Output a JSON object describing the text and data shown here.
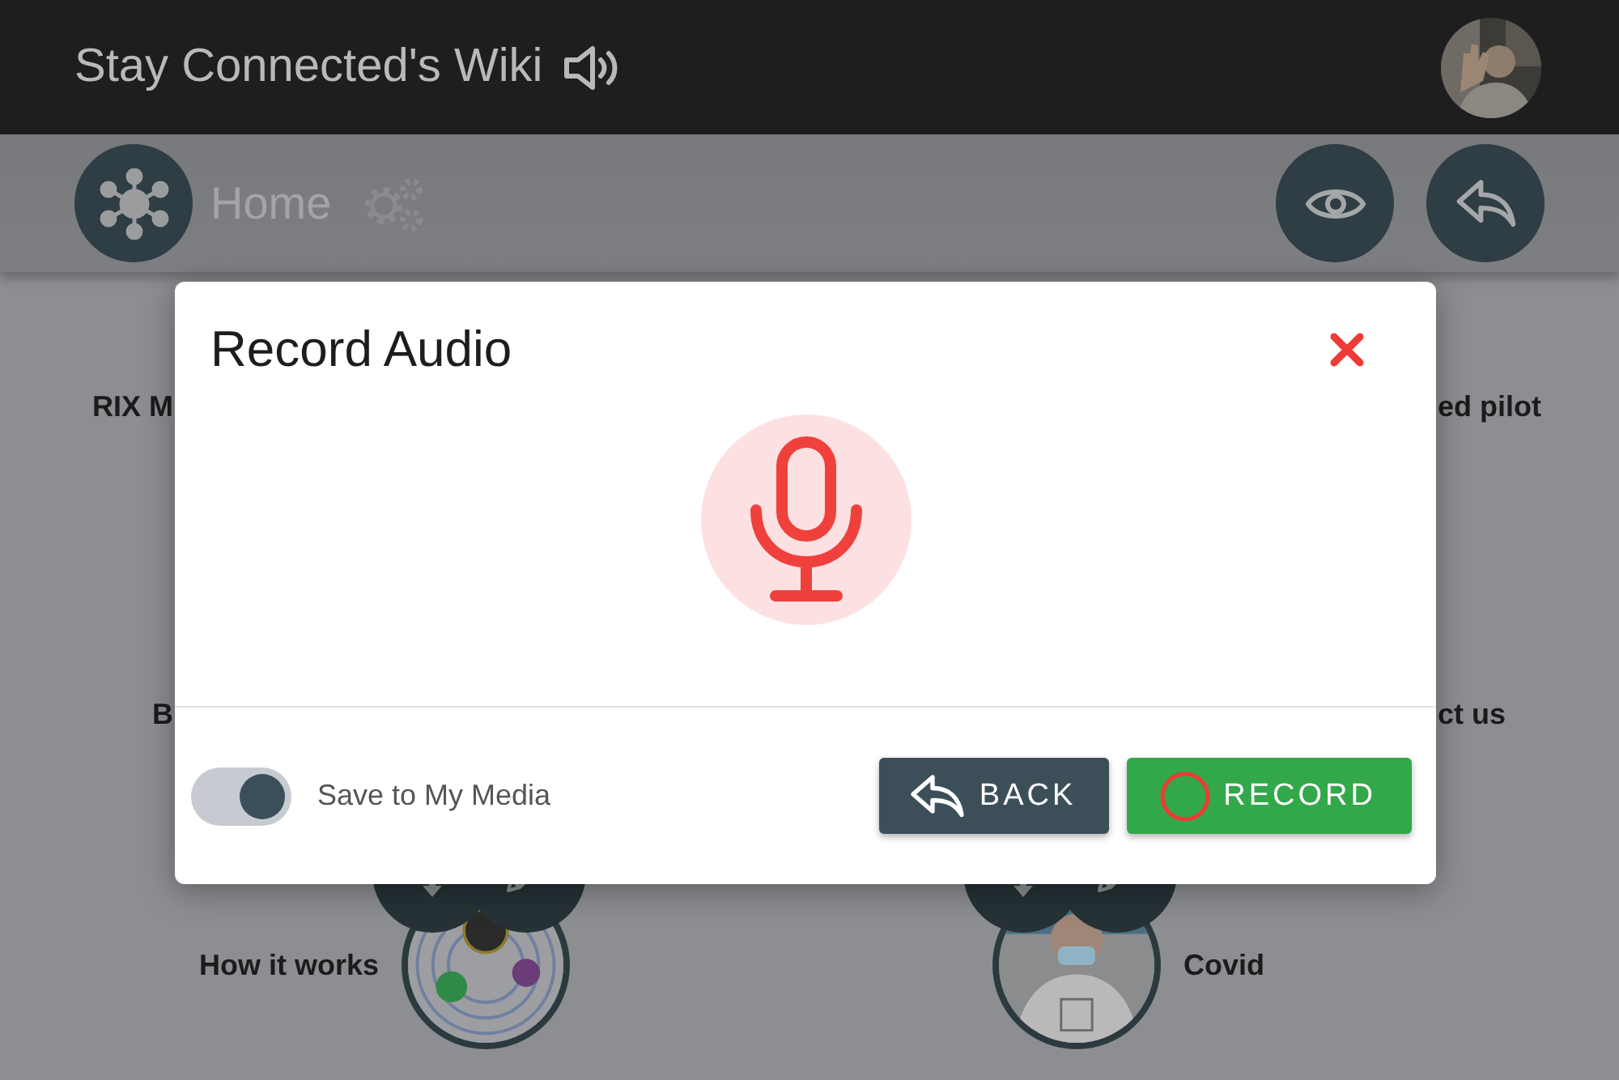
{
  "app": {
    "title": "Stay Connected's Wiki"
  },
  "toolbar": {
    "breadcrumb": "Home"
  },
  "tile_rows": [
    {
      "left": "RIX M",
      "right": "ed pilot"
    },
    {
      "left": "B",
      "right": "ct us"
    }
  ],
  "bottom_tiles": [
    {
      "label": "How it works",
      "kind": "picture"
    },
    {
      "label": "Covid",
      "kind": "picture"
    }
  ],
  "dialog": {
    "title": "Record Audio",
    "save_toggle": {
      "label": "Save to My Media",
      "on": true
    },
    "buttons": [
      {
        "label": "BACK",
        "kind": "back"
      },
      {
        "label": "RECORD",
        "kind": "record"
      }
    ]
  }
}
